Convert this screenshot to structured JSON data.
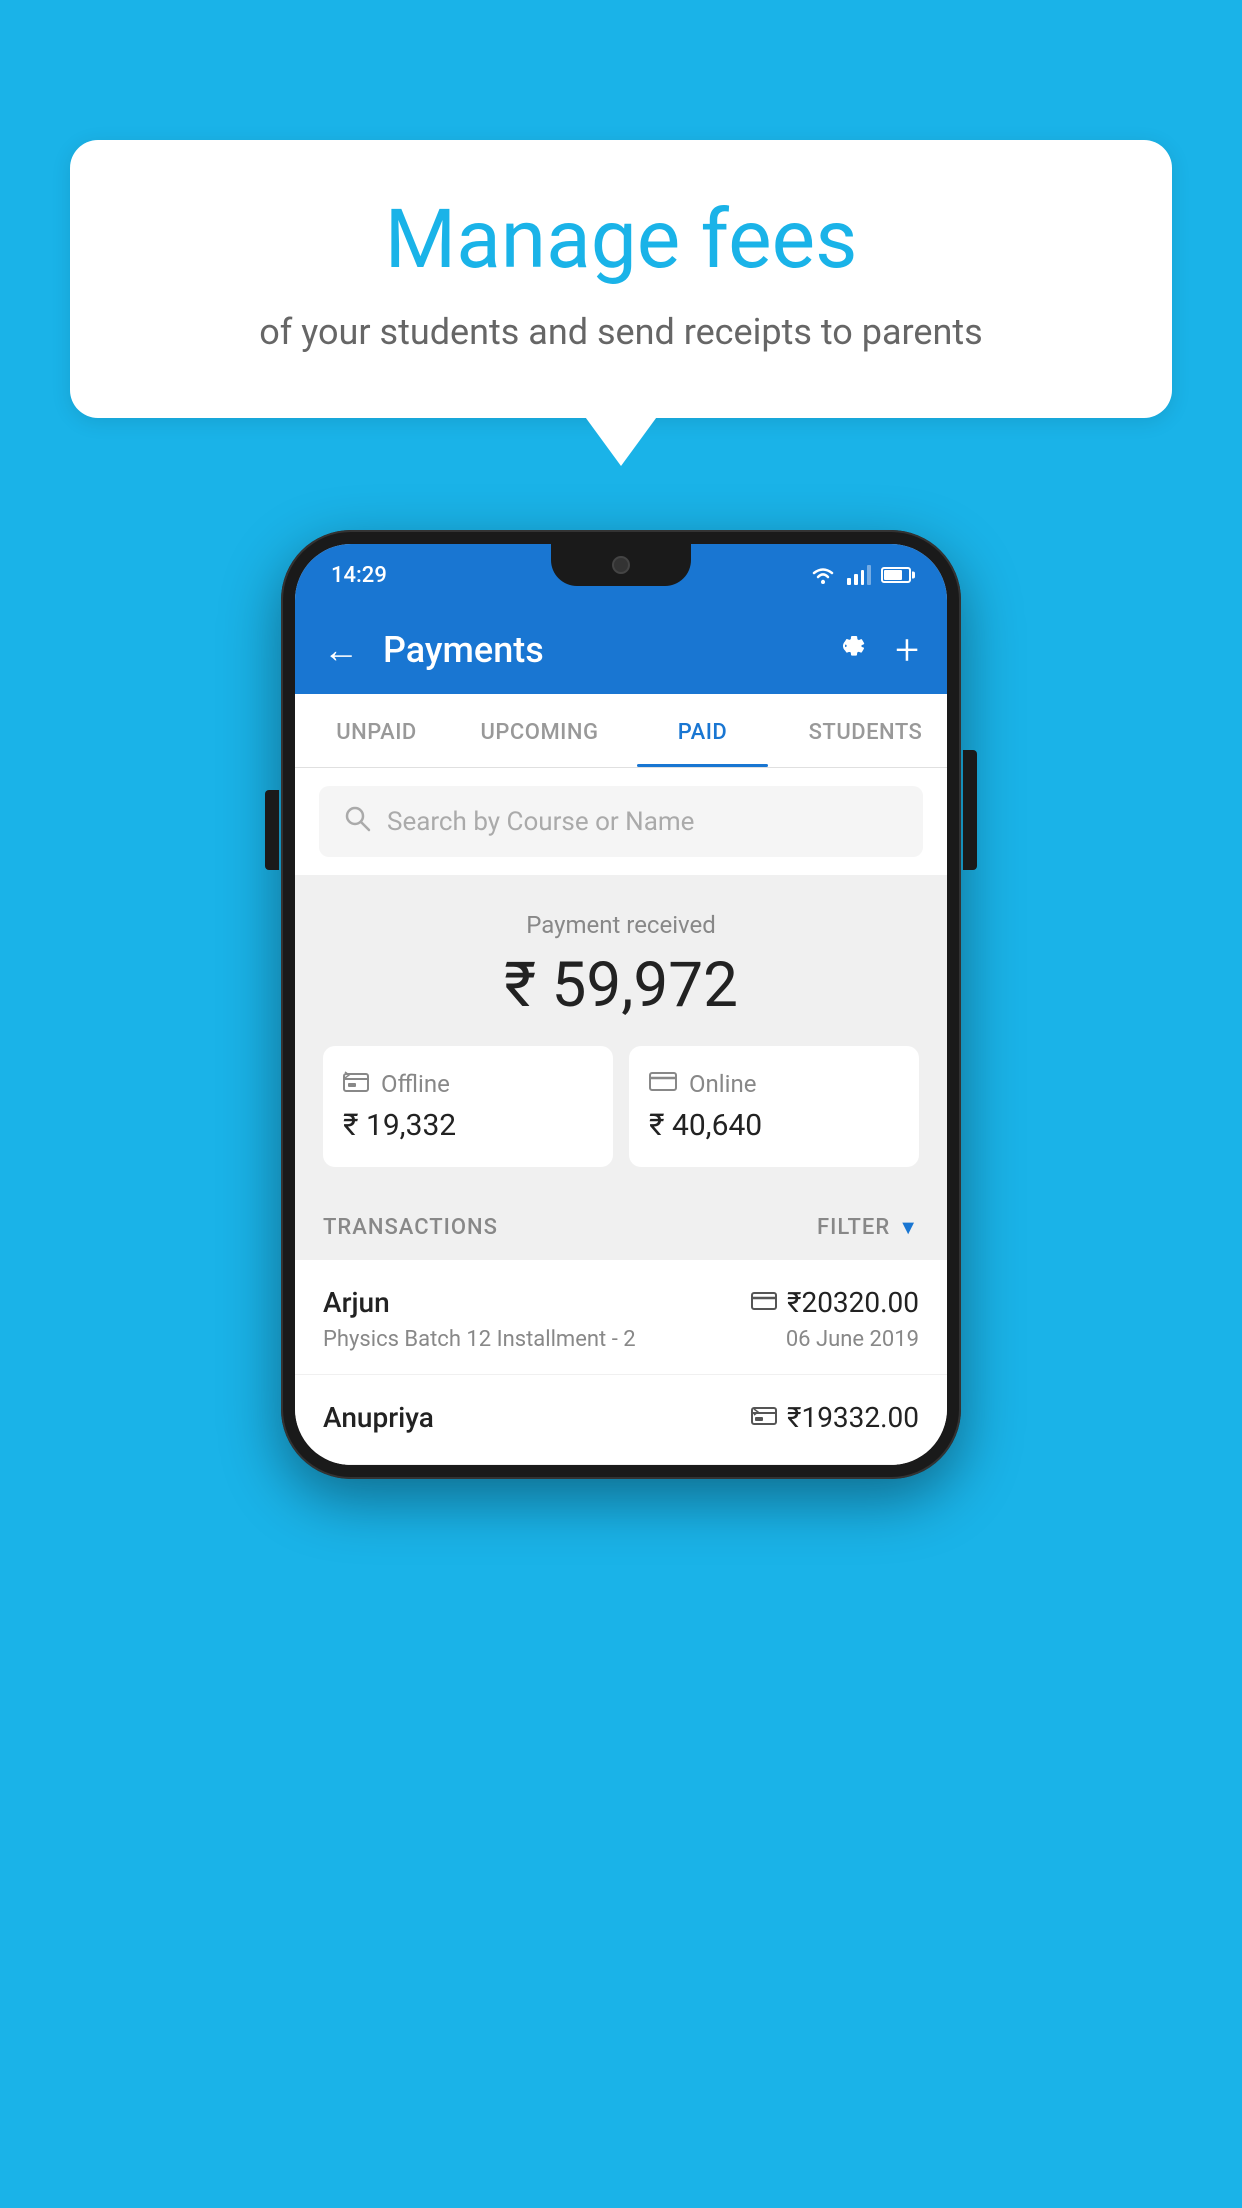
{
  "background_color": "#1ab3e8",
  "speech_bubble": {
    "title": "Manage fees",
    "subtitle": "of your students and send receipts to parents"
  },
  "status_bar": {
    "time": "14:29"
  },
  "header": {
    "title": "Payments",
    "back_label": "←",
    "gear_label": "⚙",
    "plus_label": "+"
  },
  "tabs": [
    {
      "label": "UNPAID",
      "active": false
    },
    {
      "label": "UPCOMING",
      "active": false
    },
    {
      "label": "PAID",
      "active": true
    },
    {
      "label": "STUDENTS",
      "active": false
    }
  ],
  "search": {
    "placeholder": "Search by Course or Name"
  },
  "payment_summary": {
    "received_label": "Payment received",
    "total_amount": "₹ 59,972",
    "offline": {
      "label": "Offline",
      "amount": "₹ 19,332"
    },
    "online": {
      "label": "Online",
      "amount": "₹ 40,640"
    }
  },
  "transactions": {
    "section_label": "TRANSACTIONS",
    "filter_label": "FILTER",
    "rows": [
      {
        "name": "Arjun",
        "course": "Physics Batch 12 Installment - 2",
        "amount": "₹20320.00",
        "date": "06 June 2019",
        "payment_type": "online"
      },
      {
        "name": "Anupriya",
        "course": "",
        "amount": "₹19332.00",
        "date": "",
        "payment_type": "offline"
      }
    ]
  }
}
